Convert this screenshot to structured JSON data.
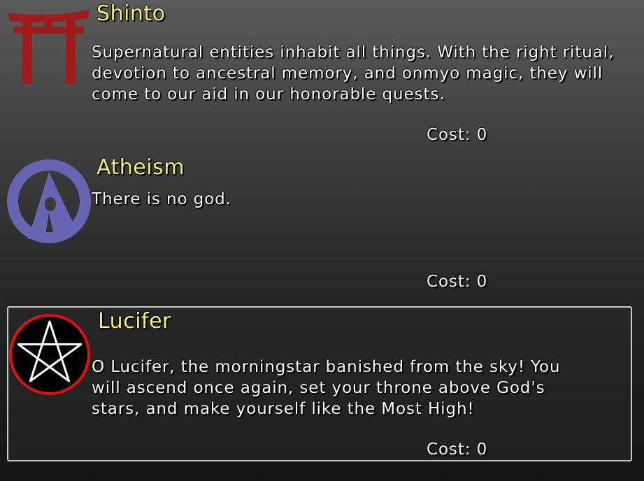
{
  "religions": [
    {
      "name": "Shinto",
      "description": "Supernatural entities inhabit all things. With the right ritual, devotion to ancestral memory, and onmyo magic, they will come to our aid in our honorable quests.",
      "cost_label": "Cost:",
      "cost": "0",
      "icon": "torii-gate-icon",
      "icon_color": "#9e1c1c",
      "selected": false
    },
    {
      "name": "Atheism",
      "description": "There is no god.",
      "cost_label": "Cost:",
      "cost": "0",
      "icon": "atheism-symbol-icon",
      "icon_color": "#6565b3",
      "selected": false
    },
    {
      "name": "Lucifer",
      "description": "O Lucifer, the morningstar banished from the sky! You will ascend once again, set your throne above God's stars, and make yourself like the Most High!",
      "cost_label": "Cost:",
      "cost": "0",
      "icon": "pentagram-icon",
      "icon_color": "#e01010",
      "selected": true
    }
  ],
  "colors": {
    "title": "#f4f07a",
    "text": "#ffffff",
    "selected_border": "#c8c8c8"
  }
}
